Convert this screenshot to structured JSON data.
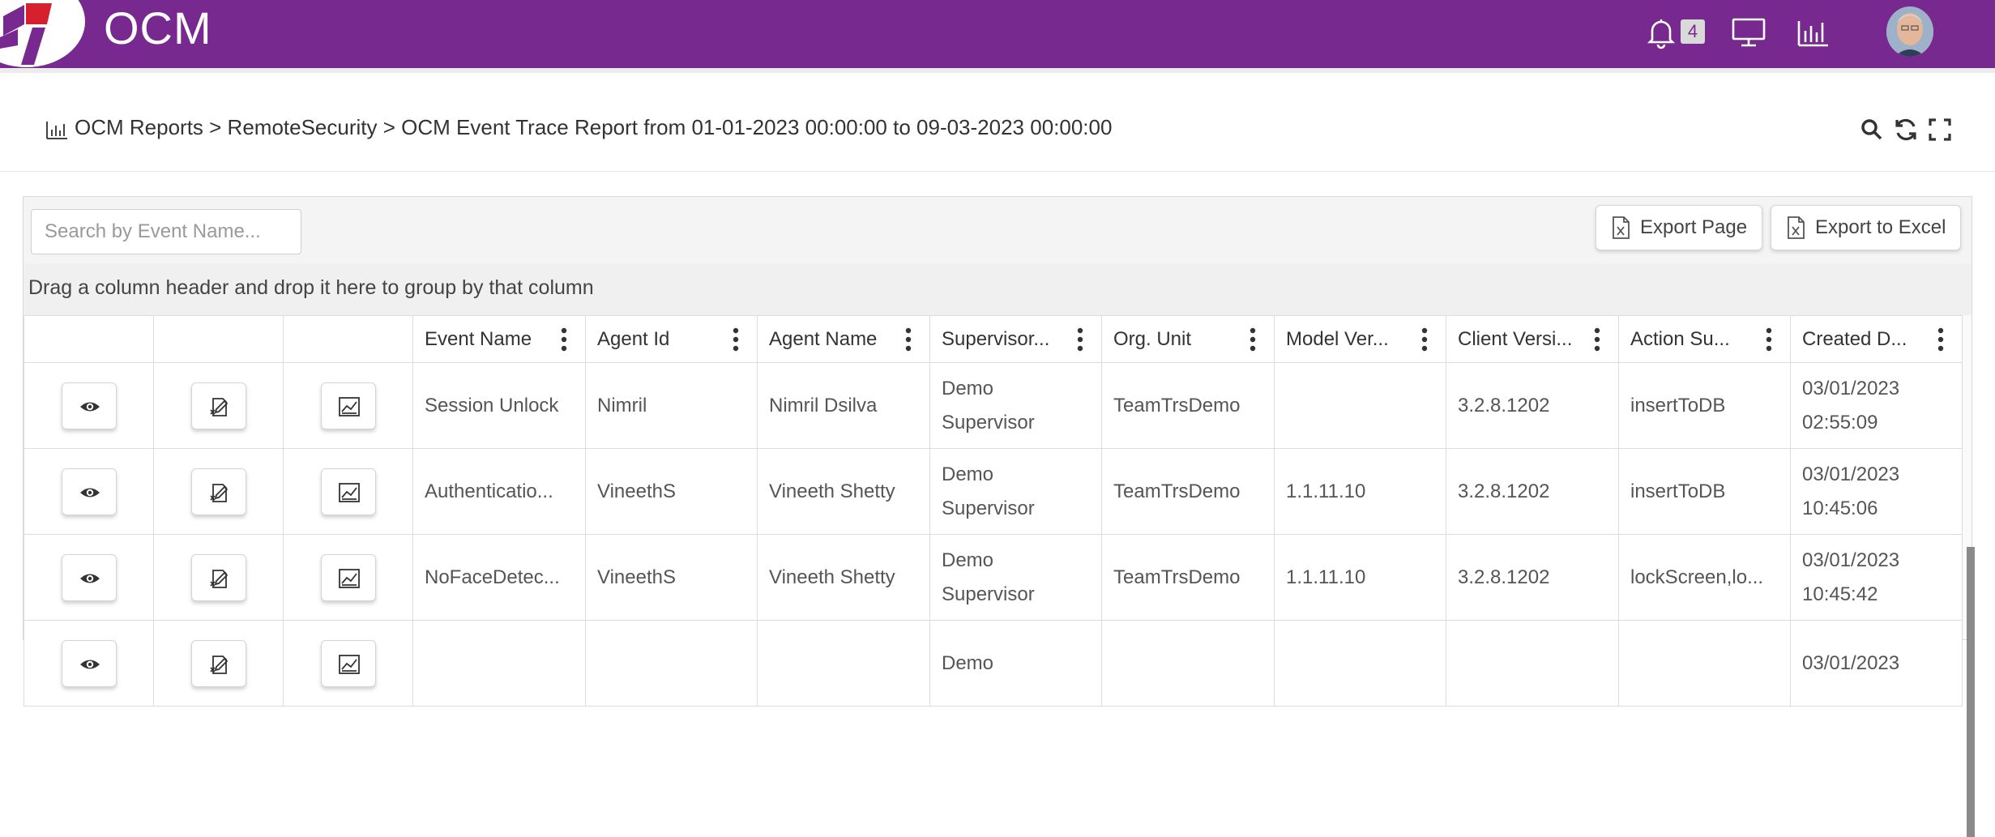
{
  "colors": {
    "brand": "#78298f",
    "logo_red": "#d6202e",
    "badge_bg": "#d9d9d9"
  },
  "header": {
    "brand": "OCM",
    "notification_count": "4",
    "icons": [
      "bell-icon",
      "monitor-icon",
      "bar-chart-icon",
      "avatar"
    ]
  },
  "breadcrumb": {
    "text": "OCM Reports > RemoteSecurity > OCM Event Trace Report from 01-01-2023 00:00:00 to 09-03-2023 00:00:00",
    "tools": [
      "search-icon",
      "refresh-icon",
      "fullscreen-icon"
    ]
  },
  "grid": {
    "search_placeholder": "Search by Event Name...",
    "export_page_label": "Export Page",
    "export_excel_label": "Export to Excel",
    "group_hint": "Drag a column header and drop it here to group by that column",
    "columns": [
      "Event Name",
      "Agent Id",
      "Agent Name",
      "Supervisor...",
      "Org. Unit",
      "Model Ver...",
      "Client Versi...",
      "Action Su...",
      "Created D..."
    ],
    "rows": [
      {
        "event": "Session Unlock",
        "agent_id": "Nimril",
        "agent_name": "Nimril Dsilva",
        "supervisor": "Demo Supervisor",
        "org_unit": "TeamTrsDemo",
        "model_ver": "",
        "client_ver": "3.2.8.1202",
        "action": "insertToDB",
        "created_date": "03/01/2023",
        "created_time": "02:55:09"
      },
      {
        "event": "Authenticatio...",
        "agent_id": "VineethS",
        "agent_name": "Vineeth Shetty",
        "supervisor": "Demo Supervisor",
        "org_unit": "TeamTrsDemo",
        "model_ver": "1.1.11.10",
        "client_ver": "3.2.8.1202",
        "action": "insertToDB",
        "created_date": "03/01/2023",
        "created_time": "10:45:06"
      },
      {
        "event": "NoFaceDetec...",
        "agent_id": "VineethS",
        "agent_name": "Vineeth Shetty",
        "supervisor": "Demo Supervisor",
        "org_unit": "TeamTrsDemo",
        "model_ver": "1.1.11.10",
        "client_ver": "3.2.8.1202",
        "action": "lockScreen,lo...",
        "created_date": "03/01/2023",
        "created_time": "10:45:42"
      },
      {
        "event": "",
        "agent_id": "",
        "agent_name": "",
        "supervisor": "Demo",
        "org_unit": "",
        "model_ver": "",
        "client_ver": "",
        "action": "",
        "created_date": "03/01/2023",
        "created_time": ""
      }
    ]
  }
}
